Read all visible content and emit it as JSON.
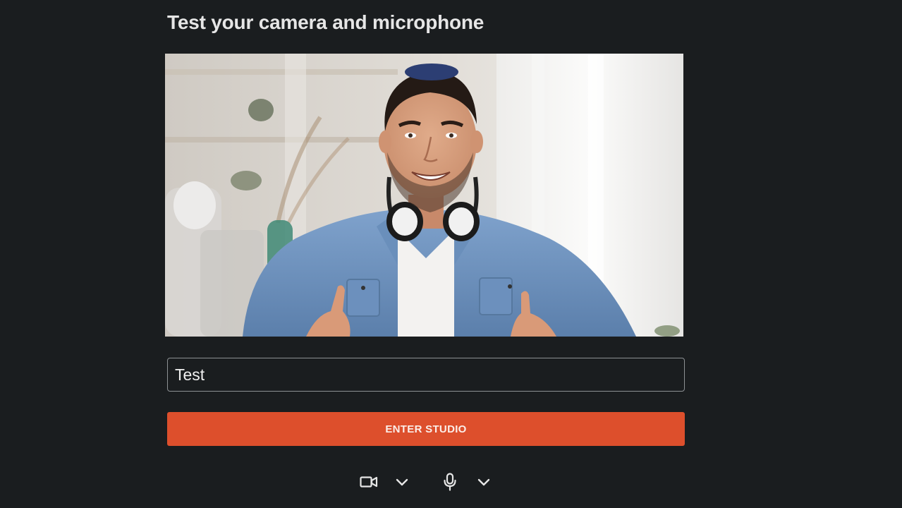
{
  "header": {
    "title": "Test your camera and microphone"
  },
  "preview": {
    "image": "camera-preview-smiling-man-with-headphones"
  },
  "name_input": {
    "value": "Test",
    "placeholder": ""
  },
  "enter_button": {
    "label": "ENTER STUDIO",
    "color": "#dd4f2c"
  },
  "controls": {
    "camera_icon": "camera-icon",
    "camera_menu_icon": "chevron-down-icon",
    "mic_icon": "microphone-icon",
    "mic_menu_icon": "chevron-down-icon"
  },
  "colors": {
    "background": "#1a1d1f",
    "accent": "#dd4f2c",
    "shirt": "#6f93c0"
  }
}
